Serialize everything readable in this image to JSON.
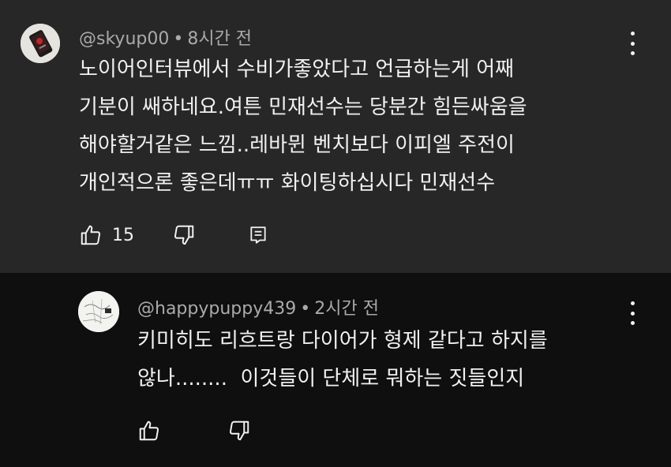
{
  "comments": [
    {
      "author": "@skyup00",
      "time": "8시간 전",
      "text": "노이어인터뷰에서 수비가좋았다고 언급하는게 어째\n기분이 쌔하네요.여튼 민재선수는 당분간 힘든싸움을\n해야할거같은 느낌..레바뮌 벤치보다 이피엘 주전이\n개인적으론 좋은데ㅠㅠ 화이팅하십시다 민재선수",
      "likes": "15"
    },
    {
      "author": "@happypuppy439",
      "time": "2시간 전",
      "text": "키미히도 리흐트랑 다이어가 형제 같다고 하지를\n않나........  이것들이 단체로 뭐하는 짓들인지",
      "likes": ""
    }
  ],
  "separator": "•",
  "colors": {
    "highlighted_background": "#272727",
    "background": "#0f0f0f",
    "text": "#f1f1f1",
    "meta_text": "#aaaaaa"
  },
  "icons": {
    "like": "thumbs-up-icon",
    "dislike": "thumbs-down-icon",
    "reply": "reply-comment-icon",
    "menu": "more-vert-icon"
  }
}
